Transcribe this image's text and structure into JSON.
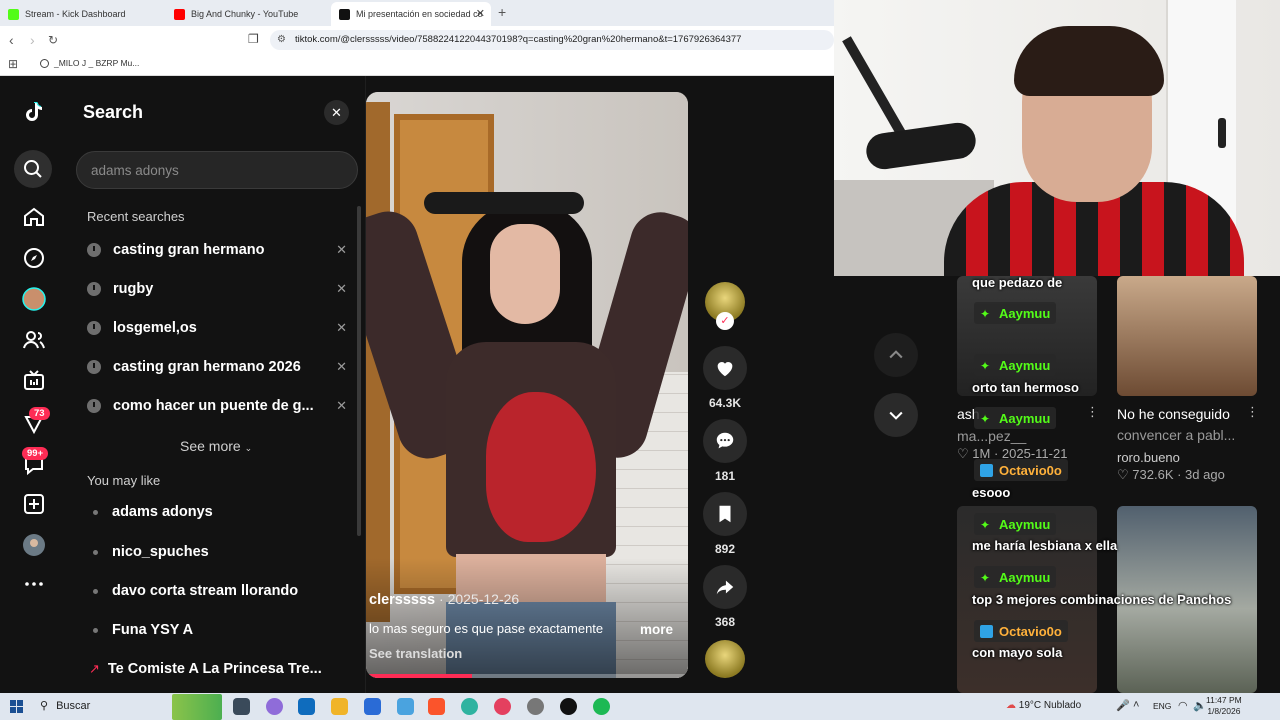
{
  "browser": {
    "tabs": [
      {
        "title": "Stream - Kick Dashboard",
        "active": false
      },
      {
        "title": "Big And Chunky - YouTube",
        "active": false
      },
      {
        "title": "Mi presentación en sociedad co",
        "active": true
      }
    ],
    "url": "tiktok.com/@clersssss/video/7588224122044370198?q=casting%20gran%20hermano&t=1767926364377",
    "bookmark": "_MILO J _ BZRP Mu..."
  },
  "rail": {
    "badges": {
      "messages": "73",
      "inbox": "99+"
    }
  },
  "search_panel": {
    "title": "Search",
    "input_value": "adams adonys",
    "recent_label": "Recent searches",
    "recent": [
      "casting gran hermano",
      "rugby",
      "losgemel,os",
      "casting gran hermano 2026",
      "como hacer un puente de g..."
    ],
    "see_more": "See more",
    "like_label": "You may like",
    "likes": [
      "adams adonys",
      "nico_spuches",
      "davo corta stream llorando",
      "Funa YSY A",
      "Te Comiste A La Princesa Tre..."
    ]
  },
  "video": {
    "author": "clersssss",
    "date": " · 2025-12-26",
    "caption": "lo mas seguro es que pase exactamente",
    "more": "more",
    "see_translation": "See translation",
    "progress": 0.33,
    "likes": "64.3K",
    "comments": "181",
    "saves": "892",
    "shares": "368"
  },
  "grid": {
    "items": [
      {
        "title": "ash",
        "author": "ma...pez__",
        "stats": "1M · 2025-11-21"
      },
      {
        "title": "No he conseguido",
        "subtitle": "convencer a pabl...",
        "author": "roro.bueno",
        "stats": "732.6K · 3d ago"
      }
    ]
  },
  "chat": {
    "lines": [
      {
        "user": "Aaymuu",
        "msg": "que pedazo de"
      },
      {
        "user": "Aaymuu",
        "msg": "orto tan hermoso"
      },
      {
        "user": "Aaymuu",
        "msg": ""
      },
      {
        "user": "Octavio0o",
        "msg": "esooo"
      },
      {
        "user": "Aaymuu",
        "msg": "me haría lesbiana x ella"
      },
      {
        "user": "Aaymuu",
        "msg": "top 3 mejores combinaciones de Panchos"
      },
      {
        "user": "Octavio0o",
        "msg": "con mayo sola"
      }
    ]
  },
  "taskbar": {
    "search": "Buscar",
    "weather": "19°C  Nublado",
    "lang": "ENG",
    "time": "11:47 PM",
    "date": "1/8/2026"
  },
  "colors": {
    "accent": "#fe2c55",
    "kick_green": "#53fc18"
  }
}
